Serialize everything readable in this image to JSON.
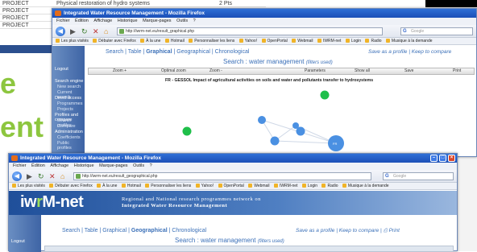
{
  "background_table": {
    "rows": [
      {
        "type": "PROJECT",
        "title": "Physical restoration of hydro systems",
        "value": "2 Pts"
      },
      {
        "type": "PROJECT",
        "title": "",
        "value": ""
      },
      {
        "type": "PROJECT",
        "title": "",
        "value": ""
      },
      {
        "type": "PROJECT",
        "title": "",
        "value": ""
      }
    ]
  },
  "background_words": [
    "e",
    "ent"
  ],
  "back_window": {
    "title": "Integrated Water Resource Management - Mozilla Firefox",
    "menu": [
      "Fichier",
      "Édition",
      "Affichage",
      "Historique",
      "Marque-pages",
      "Outils",
      "?"
    ],
    "url": "http://iwrm-net.eu/result_graphical.php",
    "search_placeholder": "Google",
    "bookmarks": [
      "Les plus visités",
      "Débuter avec Firefox",
      "À la une",
      "Hotmail",
      "Personnaliser les liens",
      "Yahoo!",
      "OpenPortal",
      "Webmail",
      "IWRM-net",
      "Login",
      "Radio",
      "Musique à la demande"
    ],
    "sidebar": {
      "logout": "Logout",
      "items": [
        {
          "label": "Search engine",
          "subs": [
            "New search",
            "Current search"
          ]
        },
        {
          "label": "Direct access",
          "subs": [
            "Programmes",
            "Projects"
          ]
        },
        {
          "label": "Profiles and compare",
          "subs": [
            "Search profiles",
            "Compare"
          ]
        },
        {
          "label": "Administration",
          "subs": [
            "Coefficients",
            "Public profiles"
          ]
        }
      ]
    },
    "tabs": [
      "Search",
      "Table",
      "Graphical",
      "Geographical",
      "Chronological"
    ],
    "active_tab": "Graphical",
    "right_links": [
      "Save as a profile",
      "Keep to compare"
    ],
    "search_label": "Search : water management",
    "filters_note": "(filters used)",
    "toolbar": [
      "Zoom +",
      "Optimal zoom",
      "Zoom -",
      "Parameters",
      "Show all",
      "Save",
      "Print"
    ],
    "graph_title": "FR - GESSOL Impact of agricultural activities on soils and water and pollutants transfer to hydrosystems",
    "node_label": "FR",
    "colors": {
      "green_node": "#1fbf4a",
      "blue_node": "#4a90e2",
      "accent": "#3b70b8"
    }
  },
  "front_window": {
    "title": "Integrated Water Resource Management - Mozilla Firefox",
    "menu": [
      "Fichier",
      "Édition",
      "Affichage",
      "Historique",
      "Marque-pages",
      "Outils",
      "?"
    ],
    "url": "http://iwrm-net.eu/result_geographical.php",
    "search_placeholder": "Google",
    "bookmarks": [
      "Les plus visités",
      "Débuter avec Firefox",
      "À la une",
      "Hotmail",
      "Personnaliser les liens",
      "Yahoo!",
      "OpenPortal",
      "Webmail",
      "IWRM-net",
      "Login",
      "Radio",
      "Musique à la demande"
    ],
    "logo": {
      "part1": "iw",
      "part2": "r",
      "part3": "M-net"
    },
    "banner_line1": "Regional and National research programmes network on",
    "banner_line2": "Integrated Water Resource Management",
    "sidebar": {
      "logout": "Logout"
    },
    "tabs": [
      "Search",
      "Table",
      "Graphical",
      "Geographical",
      "Chronological"
    ],
    "active_tab": "Geographical",
    "right_links": [
      "Save as a profile",
      "Keep to compare"
    ],
    "print_label": "Print",
    "search_label": "Search : water management",
    "filters_note": "(filters used)"
  }
}
